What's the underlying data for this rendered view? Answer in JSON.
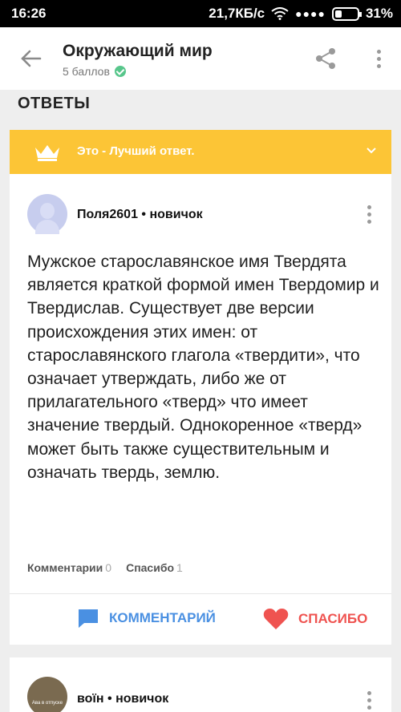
{
  "status_bar": {
    "time": "16:26",
    "network_speed": "21,7КБ/с",
    "battery": "31%",
    "battery_level": 0.31
  },
  "app_bar": {
    "title": "Окружающий мир",
    "subtitle": "5 баллов",
    "icons": [
      "back-arrow-icon",
      "share-icon",
      "more-vert-icon"
    ]
  },
  "section": {
    "title": "ОТВЕТЫ"
  },
  "answers": [
    {
      "best_label": "Это - Лучший ответ.",
      "author": "Поля2601",
      "rank": "новичок",
      "text": "Мужское старославянское имя Твердята является краткой формой имен Твердомир и Твердислав. Существует две версии происхождения этих имен: от старославянского глагола «твердити», что означает утверждать, либо же от прилагательного «тверд» что имеет значение твердый. Однокоренное «тверд» может быть также существительным и означать твердь, землю.",
      "comments_label": "Комментарии",
      "comments_count": "0",
      "thanks_label": "Спасибо",
      "thanks_count": "1",
      "comment_button": "КОММЕНТАРИЙ",
      "thanks_button": "СПАСИБО"
    },
    {
      "author": "воїн",
      "rank": "новичок",
      "avatar_text": "Ава в отпуске"
    }
  ],
  "colors": {
    "best_bar": "#fcc536",
    "comment": "#4a90e2",
    "thanks": "#ef5350",
    "check": "#57c68b"
  }
}
